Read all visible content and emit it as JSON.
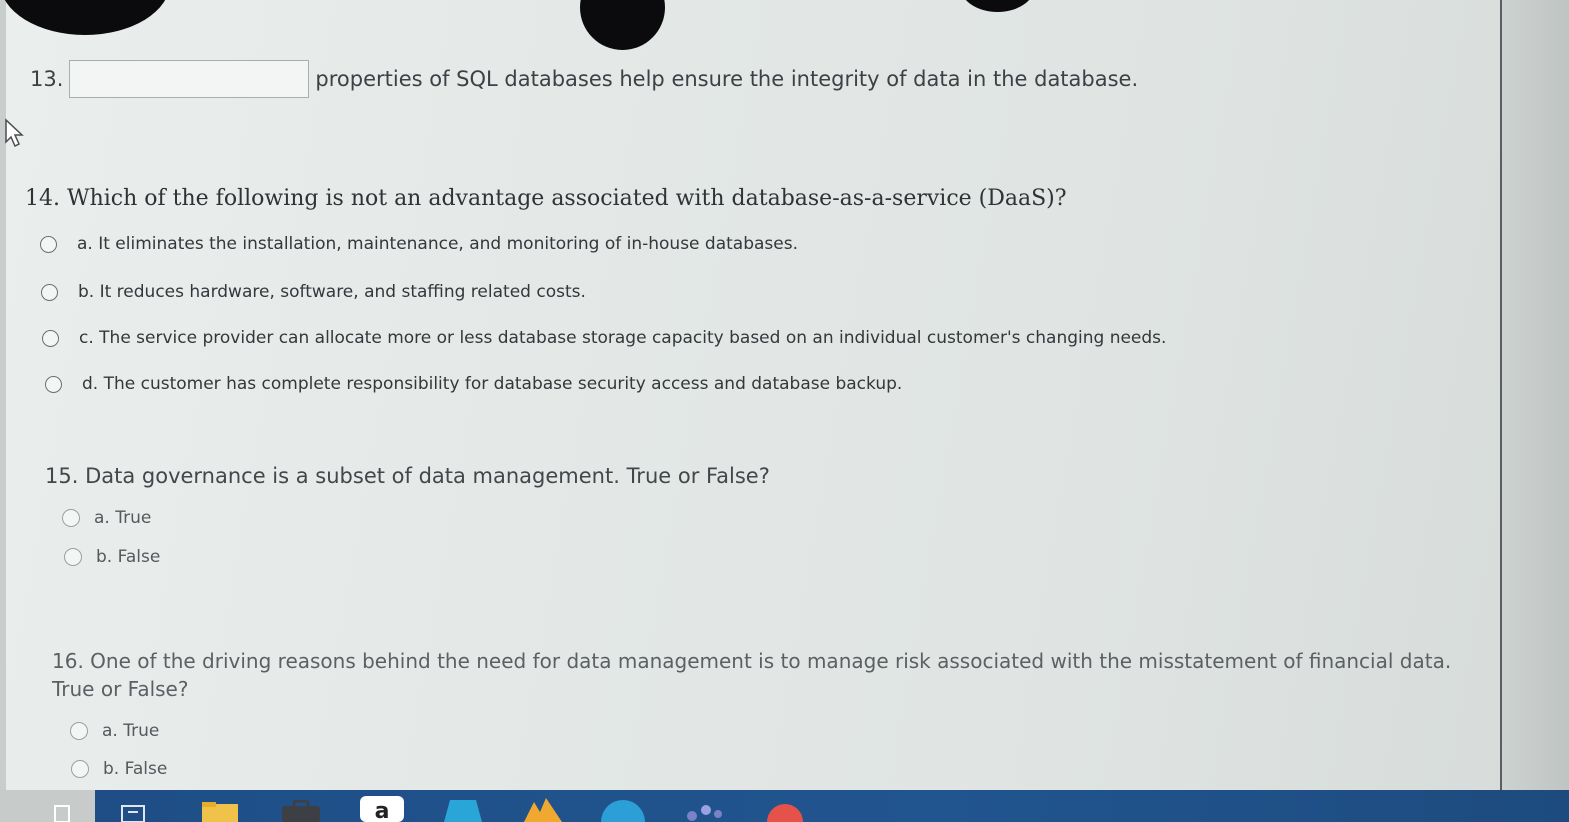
{
  "q13": {
    "number": "13.",
    "text": "properties of SQL databases help ensure the integrity of data in the database."
  },
  "q14": {
    "title": "14. Which of the following is not an advantage associated with database-as-a-service (DaaS)?",
    "options": [
      "a. It eliminates the installation, maintenance, and monitoring of in-house databases.",
      "b. It reduces hardware, software, and staffing related costs.",
      "c. The service provider can allocate more or less database storage capacity based on an individual customer's changing needs.",
      "d. The customer has complete responsibility for database security access and database backup."
    ]
  },
  "q15": {
    "title": "15. Data governance is a subset of data management. True or False?",
    "options": [
      "a. True",
      "b. False"
    ]
  },
  "q16": {
    "title": "16. One of the driving reasons behind the need for data management is to manage risk associated with the misstatement of financial data. True or False?",
    "options": [
      "a. True",
      "b. False"
    ]
  },
  "taskbar": {
    "icons": [
      "taskview-icon",
      "calendar-icon",
      "folder-icon",
      "briefcase-icon",
      "amazon-icon",
      "store-icon",
      "app-icon",
      "chrome-icon",
      "teams-icon",
      "media-icon"
    ]
  },
  "colors": {
    "page_bg": "#e3e8e6",
    "text": "#3a3d42",
    "taskbar": "#21558f"
  }
}
